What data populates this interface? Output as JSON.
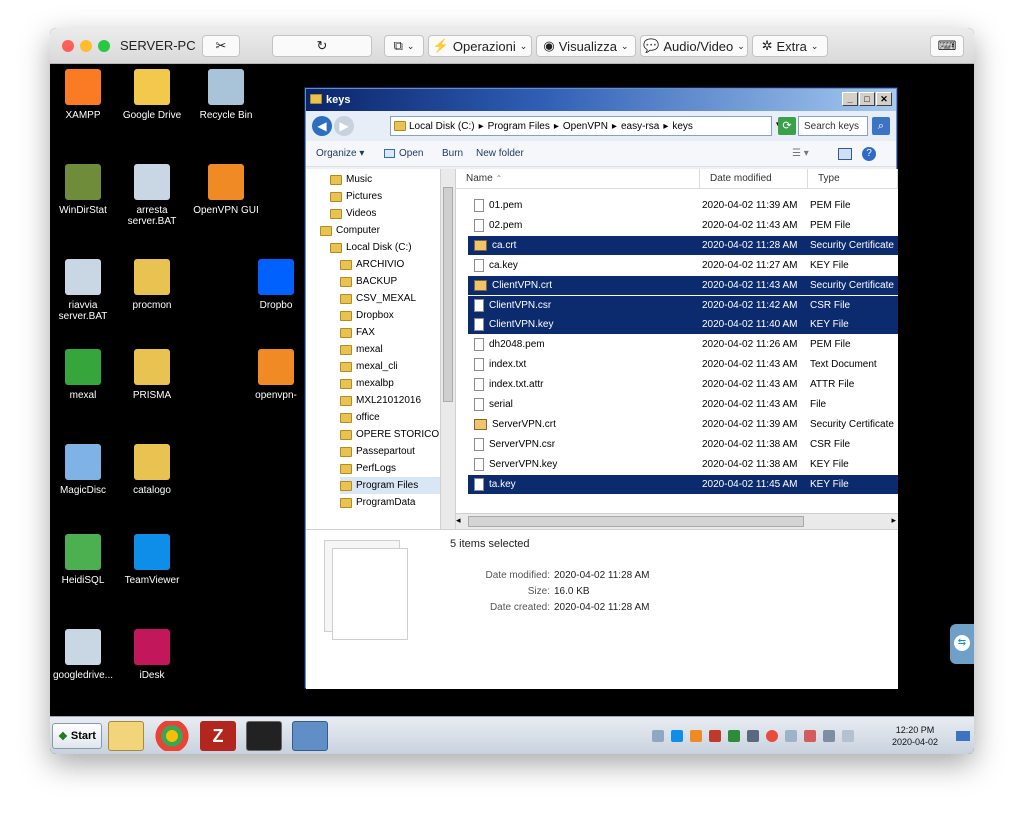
{
  "mac": {
    "title": "SERVER-PC",
    "toolbar": {
      "operazioni": "Operazioni",
      "visualizza": "Visualizza",
      "audio_video": "Audio/Video",
      "extra": "Extra"
    }
  },
  "desktop_icons": [
    {
      "label": "XAMPP",
      "color": "#fb7a24"
    },
    {
      "label": "Google Drive",
      "color": "#f2c94c"
    },
    {
      "label": "Recycle Bin",
      "color": "#a9c4d9"
    },
    {
      "label": "WinDirStat",
      "color": "#6f8c3a"
    },
    {
      "label": "arresta server.BAT",
      "color": "#c9d6e3"
    },
    {
      "label": "OpenVPN GUI",
      "color": "#f08a24"
    },
    {
      "label": "riavvia server.BAT",
      "color": "#c9d6e3"
    },
    {
      "label": "procmon",
      "color": "#e8c352"
    },
    {
      "label": "Dropbo",
      "color": "#0061fe"
    },
    {
      "label": "mexal",
      "color": "#36a63c"
    },
    {
      "label": "PRISMA",
      "color": "#e8c352"
    },
    {
      "label": "openvpn-",
      "color": "#f08a24"
    },
    {
      "label": "MagicDisc",
      "color": "#7fb2e5"
    },
    {
      "label": "catalogo",
      "color": "#e8c352"
    },
    {
      "label": "HeidiSQL",
      "color": "#4caf50"
    },
    {
      "label": "TeamViewer",
      "color": "#0e8ee9"
    },
    {
      "label": "googledrive...",
      "color": "#c9d6e3"
    },
    {
      "label": "iDesk",
      "color": "#c2185b"
    }
  ],
  "explorer": {
    "title": "keys",
    "breadcrumb": [
      "Local Disk (C:)",
      "Program Files",
      "OpenVPN",
      "easy-rsa",
      "keys"
    ],
    "search_placeholder": "Search keys",
    "commands": {
      "organize": "Organize",
      "open": "Open",
      "burn": "Burn",
      "new_folder": "New folder"
    },
    "nav": [
      {
        "label": "Music",
        "indent": 1
      },
      {
        "label": "Pictures",
        "indent": 1
      },
      {
        "label": "Videos",
        "indent": 1
      },
      {
        "label": "Computer",
        "indent": 0
      },
      {
        "label": "Local Disk (C:)",
        "indent": 1
      },
      {
        "label": "ARCHIVIO",
        "indent": 2
      },
      {
        "label": "BACKUP",
        "indent": 2
      },
      {
        "label": "CSV_MEXAL",
        "indent": 2
      },
      {
        "label": "Dropbox",
        "indent": 2
      },
      {
        "label": "FAX",
        "indent": 2
      },
      {
        "label": "mexal",
        "indent": 2
      },
      {
        "label": "mexal_cli",
        "indent": 2
      },
      {
        "label": "mexalbp",
        "indent": 2
      },
      {
        "label": "MXL21012016",
        "indent": 2
      },
      {
        "label": "office",
        "indent": 2
      },
      {
        "label": "OPERE STORICO",
        "indent": 2
      },
      {
        "label": "Passepartout",
        "indent": 2
      },
      {
        "label": "PerfLogs",
        "indent": 2
      },
      {
        "label": "Program Files",
        "indent": 2
      },
      {
        "label": "ProgramData",
        "indent": 2
      }
    ],
    "columns": {
      "name": "Name",
      "date": "Date modified",
      "type": "Type"
    },
    "files": [
      {
        "name": "01.pem",
        "date": "2020-04-02 11:39 AM",
        "type": "PEM File",
        "selected": false,
        "cert": false
      },
      {
        "name": "02.pem",
        "date": "2020-04-02 11:43 AM",
        "type": "PEM File",
        "selected": false,
        "cert": false
      },
      {
        "name": "ca.crt",
        "date": "2020-04-02 11:28 AM",
        "type": "Security Certificate",
        "selected": true,
        "cert": true
      },
      {
        "name": "ca.key",
        "date": "2020-04-02 11:27 AM",
        "type": "KEY File",
        "selected": false,
        "cert": false
      },
      {
        "name": "ClientVPN.crt",
        "date": "2020-04-02 11:43 AM",
        "type": "Security Certificate",
        "selected": true,
        "cert": true
      },
      {
        "name": "ClientVPN.csr",
        "date": "2020-04-02 11:42 AM",
        "type": "CSR File",
        "selected": true,
        "cert": false
      },
      {
        "name": "ClientVPN.key",
        "date": "2020-04-02 11:40 AM",
        "type": "KEY File",
        "selected": true,
        "cert": false
      },
      {
        "name": "dh2048.pem",
        "date": "2020-04-02 11:26 AM",
        "type": "PEM File",
        "selected": false,
        "cert": false
      },
      {
        "name": "index.txt",
        "date": "2020-04-02 11:43 AM",
        "type": "Text Document",
        "selected": false,
        "cert": false
      },
      {
        "name": "index.txt.attr",
        "date": "2020-04-02 11:43 AM",
        "type": "ATTR File",
        "selected": false,
        "cert": false
      },
      {
        "name": "serial",
        "date": "2020-04-02 11:43 AM",
        "type": "File",
        "selected": false,
        "cert": false
      },
      {
        "name": "ServerVPN.crt",
        "date": "2020-04-02 11:39 AM",
        "type": "Security Certificate",
        "selected": false,
        "cert": true
      },
      {
        "name": "ServerVPN.csr",
        "date": "2020-04-02 11:38 AM",
        "type": "CSR File",
        "selected": false,
        "cert": false
      },
      {
        "name": "ServerVPN.key",
        "date": "2020-04-02 11:38 AM",
        "type": "KEY File",
        "selected": false,
        "cert": false
      },
      {
        "name": "ta.key",
        "date": "2020-04-02 11:45 AM",
        "type": "KEY File",
        "selected": true,
        "cert": false
      }
    ],
    "details": {
      "count": "5 items selected",
      "modified_label": "Date modified:",
      "modified_value": "2020-04-02 11:28 AM",
      "size_label": "Size:",
      "size_value": "16.0 KB",
      "created_label": "Date created:",
      "created_value": "2020-04-02 11:28 AM"
    }
  },
  "taskbar": {
    "start": "Start",
    "clock_time": "12:20 PM",
    "clock_date": "2020-04-02"
  }
}
